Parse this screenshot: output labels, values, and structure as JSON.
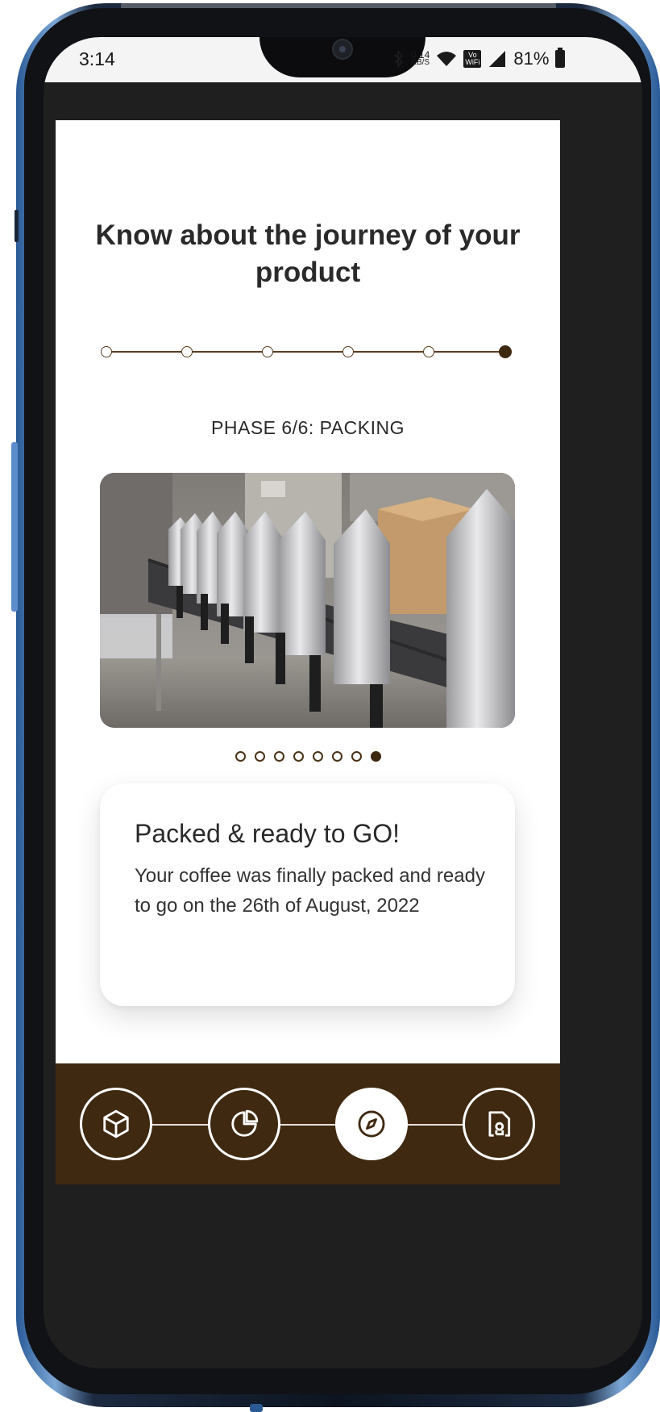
{
  "status_bar": {
    "time": "3:14",
    "net_speed_value": "0.14",
    "net_speed_unit": "KB/S",
    "volte_top": "Vo",
    "volte_bottom": "WiFi",
    "battery": "81%"
  },
  "page": {
    "title": "Know about the journey of your product",
    "phase_label": "PHASE 6/6: PACKING",
    "stepper": {
      "total_steps": 6,
      "current_step": 6
    },
    "carousel": {
      "total_slides": 8,
      "current_slide": 8
    },
    "info_card": {
      "title": "Packed & ready to GO!",
      "body": "Your coffee was finally packed and ready to go on the 26th of August, 2022"
    }
  },
  "bottom_nav": {
    "items": [
      {
        "icon": "box-icon",
        "active": false
      },
      {
        "icon": "pie-chart-icon",
        "active": false
      },
      {
        "icon": "compass-icon",
        "active": true
      },
      {
        "icon": "certificate-icon",
        "active": false
      }
    ]
  },
  "colors": {
    "brand_brown": "#3f2910",
    "accent_brown": "#5a3e22",
    "screen_bg": "#1f1f1f"
  }
}
